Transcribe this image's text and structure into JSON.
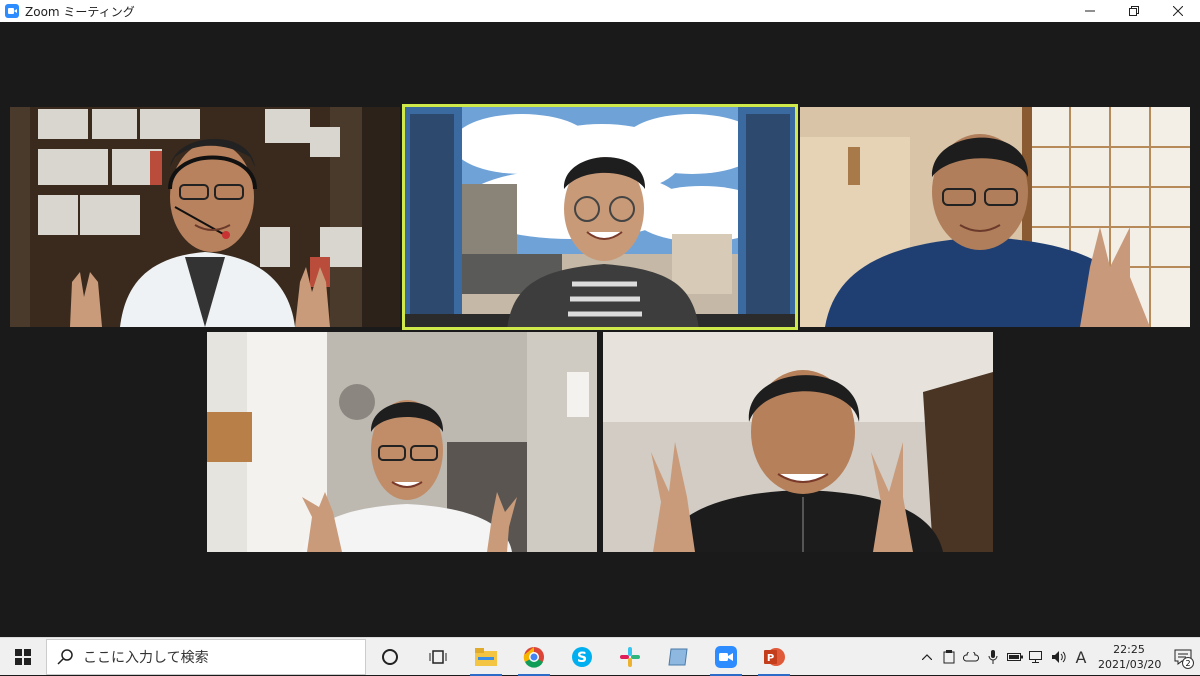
{
  "window": {
    "title": "Zoom ミーティング",
    "icon": "zoom-app-icon",
    "controls": [
      "minimize",
      "restore",
      "close"
    ]
  },
  "meeting": {
    "layout": "gallery",
    "participant_count": 5,
    "active_speaker_index": 1,
    "active_border_color": "#cfe84a",
    "background_color": "#1a1a1a",
    "tiles": [
      {
        "scene": "bookshelf-headset",
        "gesture": "peace"
      },
      {
        "scene": "virtual-background-window-clouds",
        "gesture": "none",
        "active": true
      },
      {
        "scene": "shoji-room",
        "gesture": "peace"
      },
      {
        "scene": "white-room-hallway",
        "gesture": "peace"
      },
      {
        "scene": "white-room-door",
        "gesture": "peace"
      }
    ]
  },
  "taskbar": {
    "search_placeholder": "ここに入力して検索",
    "pinned_icons": [
      "cortana-icon",
      "task-view-icon",
      "file-explorer-icon",
      "chrome-icon",
      "skype-icon",
      "slack-icon",
      "notes-icon",
      "zoom-icon",
      "powerpoint-icon"
    ],
    "ime_indicator": "A",
    "time": "22:25",
    "date": "2021/03/20",
    "notification_count": "2",
    "accent_color": "#2d6bc9"
  }
}
